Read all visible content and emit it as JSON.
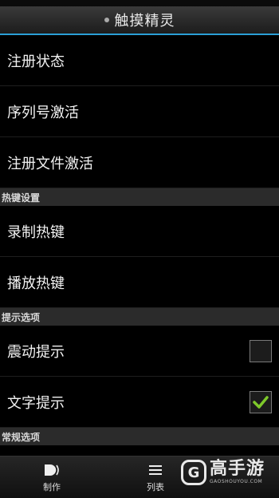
{
  "header": {
    "title": "触摸精灵"
  },
  "items_group1": [
    {
      "label": "注册状态"
    },
    {
      "label": "序列号激活"
    },
    {
      "label": "注册文件激活"
    }
  ],
  "sections": {
    "hotkeys": "热键设置",
    "prompts": "提示选项",
    "general": "常规选项"
  },
  "items_hotkeys": [
    {
      "label": "录制热键"
    },
    {
      "label": "播放热键"
    }
  ],
  "items_prompts": [
    {
      "label": "震动提示",
      "checked": false
    },
    {
      "label": "文字提示",
      "checked": true
    }
  ],
  "bottom_tabs": [
    {
      "label": "制作",
      "icon": "make-icon"
    },
    {
      "label": "列表",
      "icon": "list-icon"
    }
  ],
  "watermark": {
    "logo": "G",
    "main": "高手游",
    "sub": "GAOSHOUYOU.COM"
  },
  "colors": {
    "accent": "#2a9fd6",
    "check": "#7ec92a"
  }
}
